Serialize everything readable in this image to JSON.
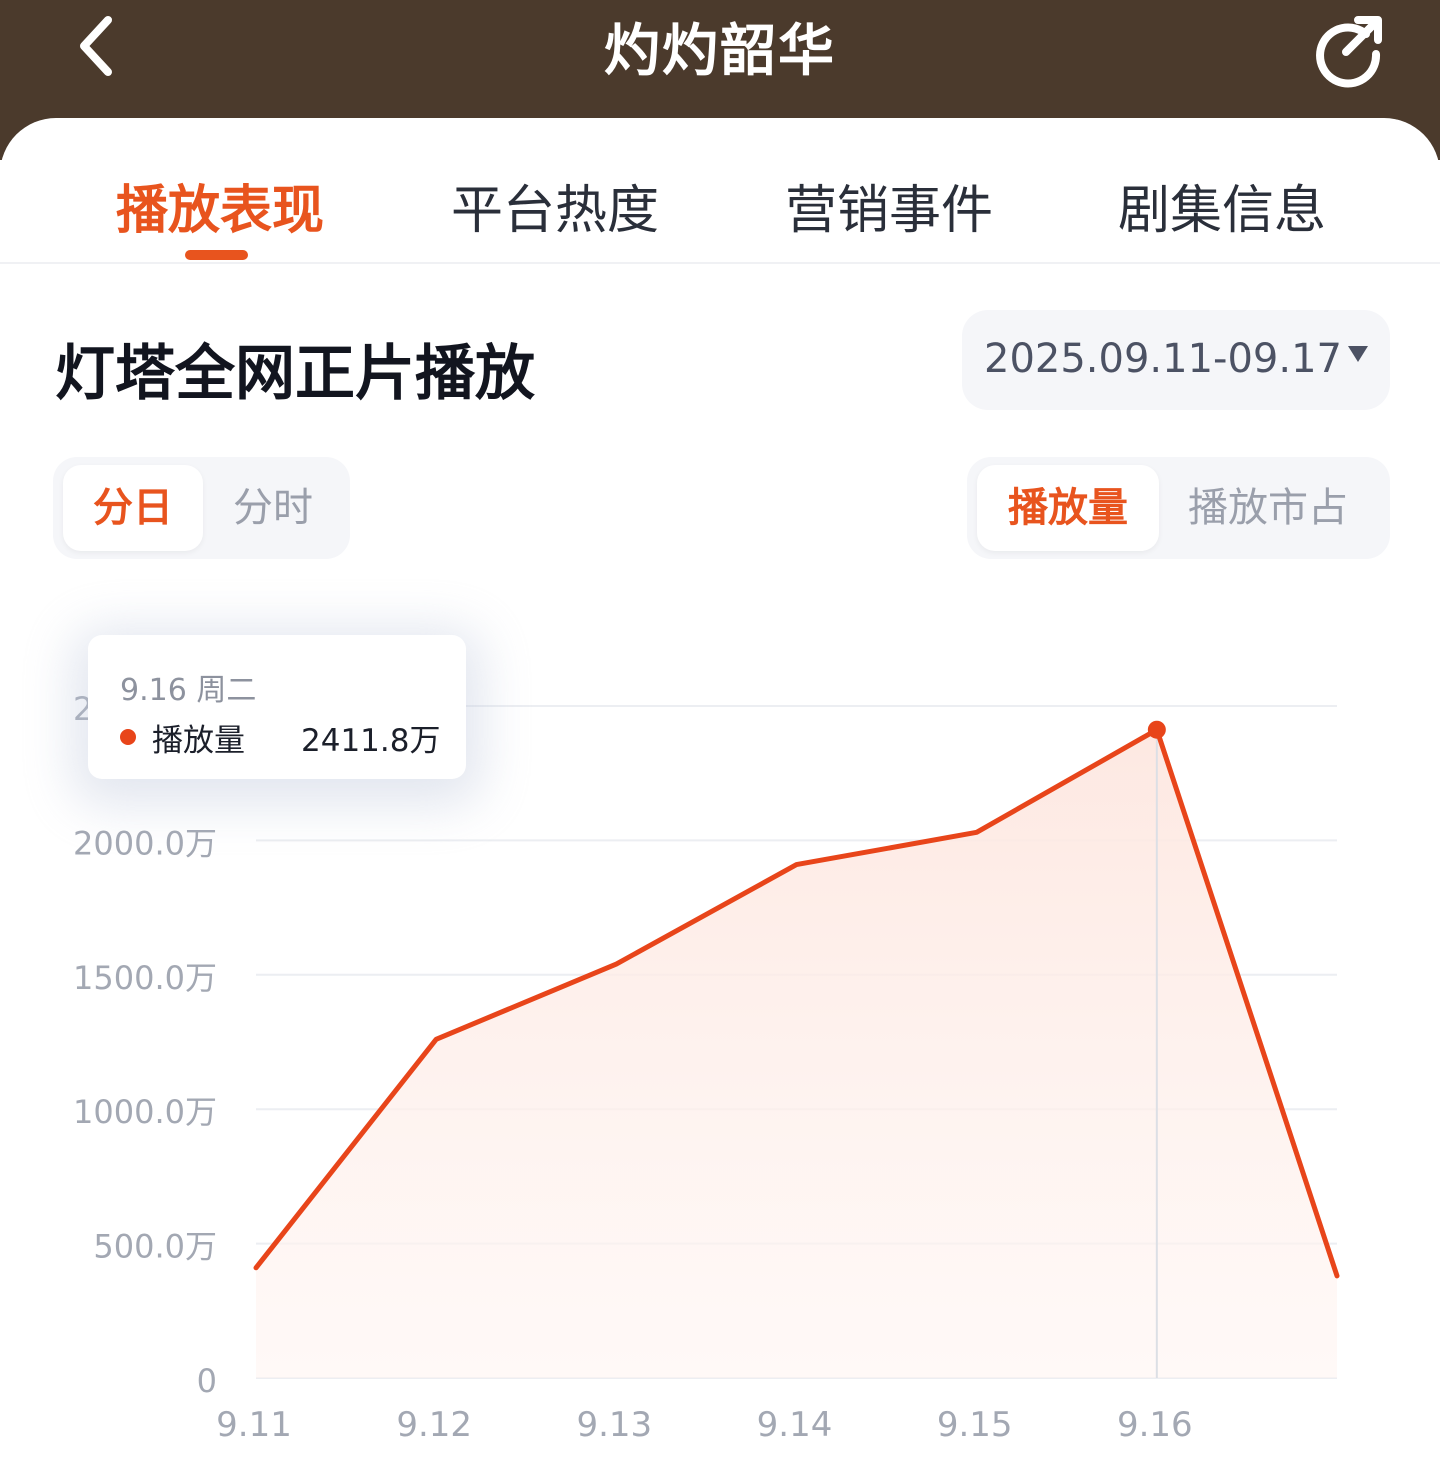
{
  "app": {
    "title": "灼灼韶华"
  },
  "tabs": [
    {
      "label": "播放表现",
      "active": true
    },
    {
      "label": "平台热度",
      "active": false
    },
    {
      "label": "营销事件",
      "active": false
    },
    {
      "label": "剧集信息",
      "active": false
    }
  ],
  "section": {
    "title": "灯塔全网正片播放"
  },
  "date_range": "2025.09.11-09.17",
  "granularity": {
    "options": [
      "分日",
      "分时"
    ],
    "selected": "分日"
  },
  "metric": {
    "options": [
      "播放量",
      "播放市占"
    ],
    "selected": "播放量"
  },
  "tooltip": {
    "date": "9.16 周二",
    "series_label": "播放量",
    "value": "2411.8万"
  },
  "colors": {
    "accent": "#e8541e",
    "line": "#e8451a",
    "header_bg": "#4b3a2c"
  },
  "chart_data": {
    "type": "area",
    "x": [
      "9.11",
      "9.12",
      "9.13",
      "9.14",
      "9.15",
      "9.16",
      "9.17"
    ],
    "visible_x_labels": [
      "9.11",
      "9.12",
      "9.13",
      "9.14",
      "9.15",
      "9.16"
    ],
    "series": [
      {
        "name": "播放量",
        "values": [
          410,
          1260,
          1540,
          1910,
          2030,
          2411.8,
          380
        ]
      }
    ],
    "y_ticks": [
      {
        "value": 0,
        "label": "0"
      },
      {
        "value": 500,
        "label": "500.0万"
      },
      {
        "value": 1000,
        "label": "1000.0万"
      },
      {
        "value": 1500,
        "label": "1500.0万"
      },
      {
        "value": 2000,
        "label": "2000.0万"
      },
      {
        "value": 2500,
        "label": "2500.0万"
      }
    ],
    "ylim": [
      0,
      2500
    ],
    "grid": true,
    "highlight_index": 5
  }
}
